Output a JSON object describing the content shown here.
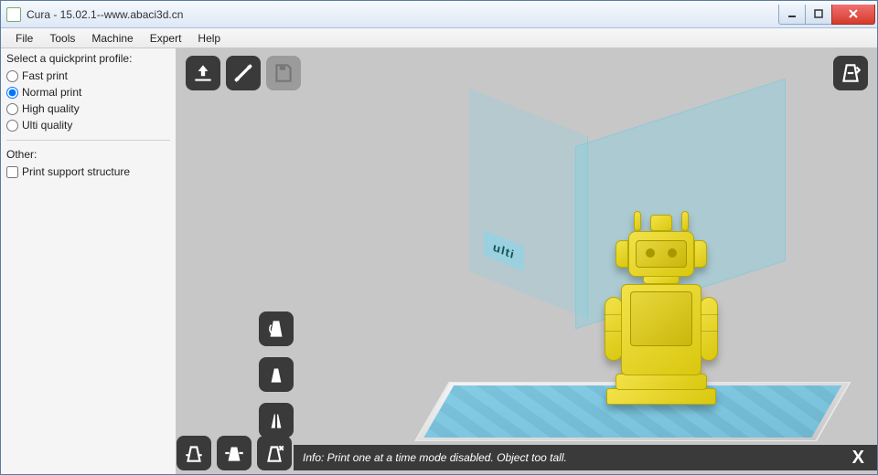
{
  "window": {
    "title": "Cura - 15.02.1--www.abaci3d.cn"
  },
  "menubar": {
    "items": [
      "File",
      "Tools",
      "Machine",
      "Expert",
      "Help"
    ]
  },
  "sidebar": {
    "heading": "Select a quickprint profile:",
    "profiles": [
      {
        "label": "Fast print",
        "selected": false
      },
      {
        "label": "Normal print",
        "selected": true
      },
      {
        "label": "High quality",
        "selected": false
      },
      {
        "label": "Ulti quality",
        "selected": false
      }
    ],
    "other_heading": "Other:",
    "support_label": "Print support structure",
    "support_checked": false
  },
  "toolbar": {
    "top_left": [
      {
        "name": "load-model-icon"
      },
      {
        "name": "slice-settings-icon"
      },
      {
        "name": "save-icon",
        "disabled": true
      }
    ],
    "top_right": {
      "name": "view-mode-icon"
    },
    "left_stack": [
      {
        "name": "rotate-icon"
      },
      {
        "name": "scale-icon"
      },
      {
        "name": "mirror-icon"
      }
    ],
    "bottom_row": [
      {
        "name": "layflat-icon"
      },
      {
        "name": "reset-transform-icon"
      },
      {
        "name": "multiply-icon"
      }
    ]
  },
  "scene": {
    "platform_label": "ulti"
  },
  "info": {
    "message": "Info: Print one at a time mode disabled. Object too tall.",
    "close": "X"
  }
}
